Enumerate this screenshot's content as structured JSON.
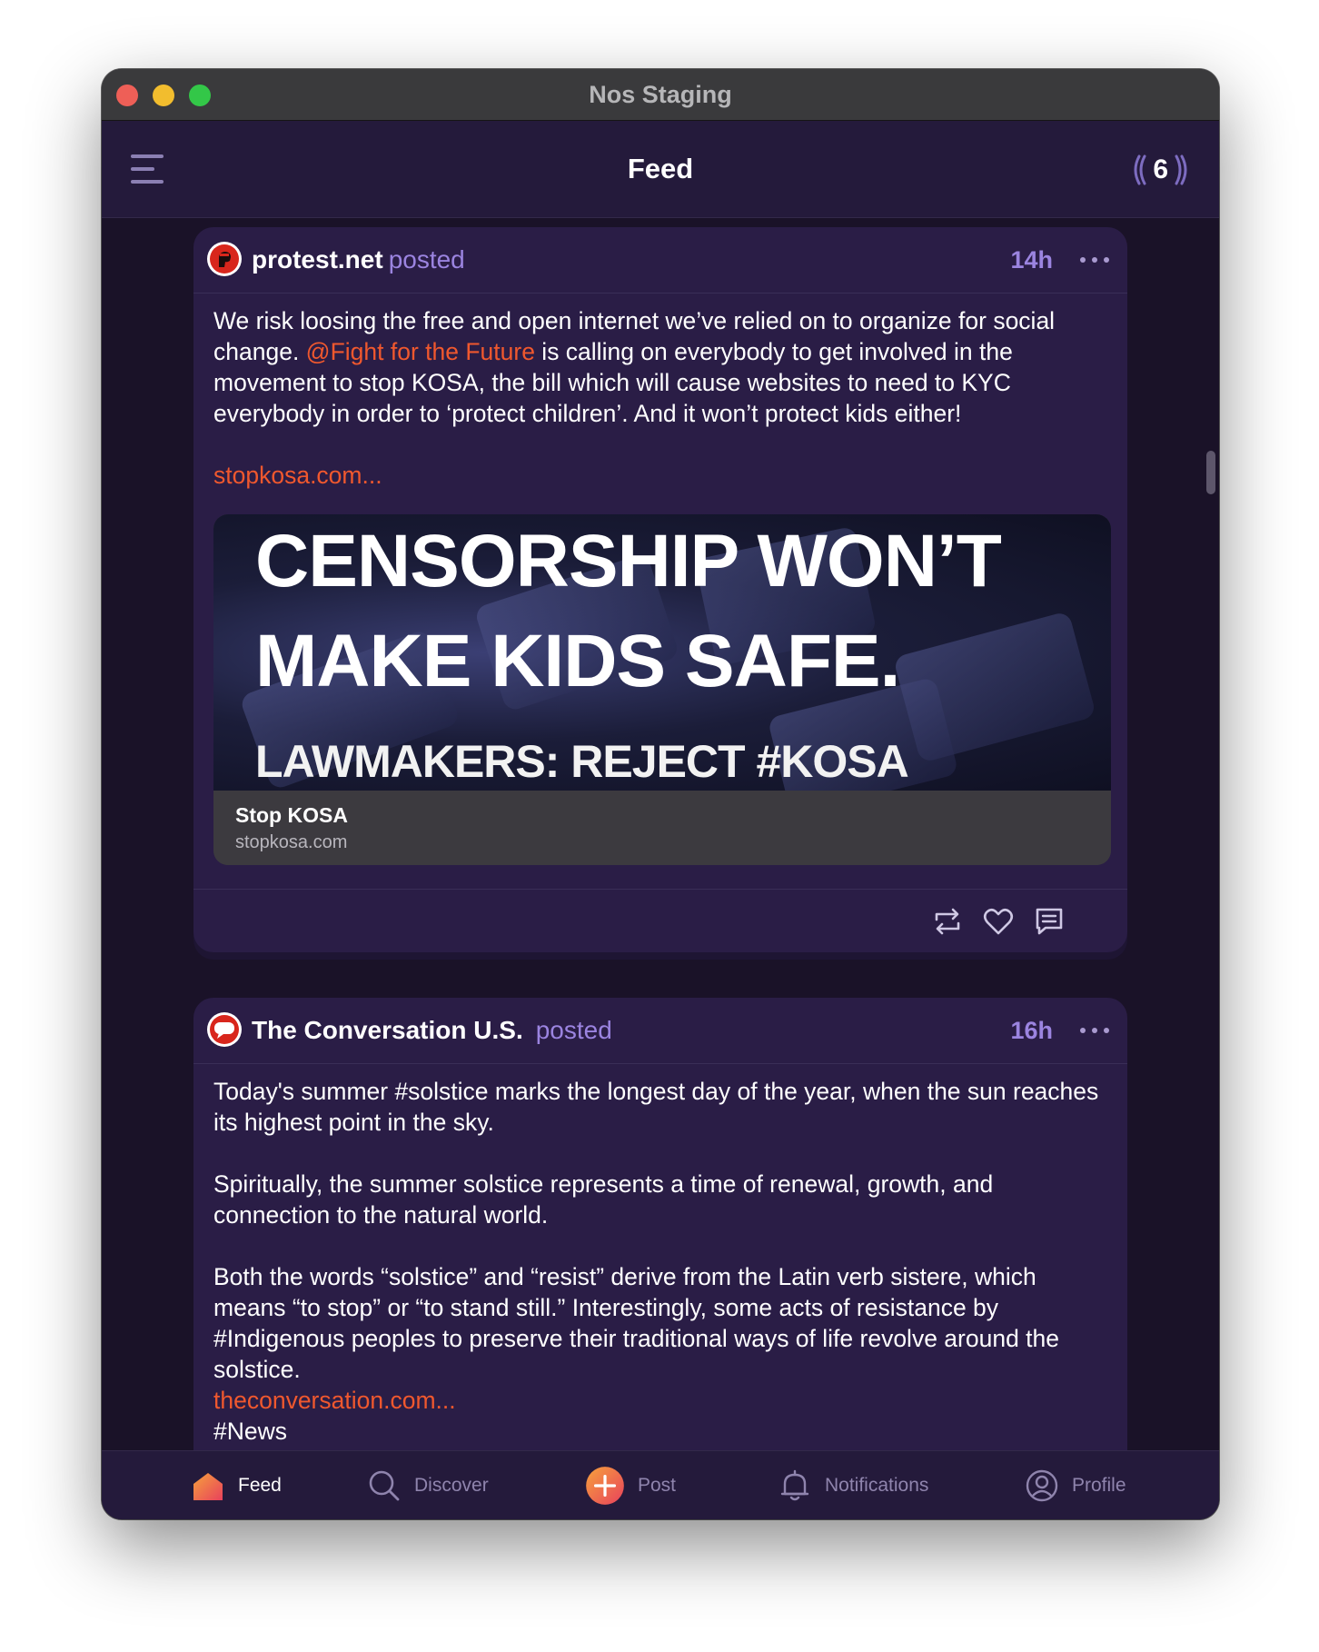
{
  "window": {
    "title": "Nos Staging"
  },
  "appbar": {
    "title": "Feed",
    "relay_count": "6"
  },
  "posts": [
    {
      "author": "protest.net",
      "action": "posted",
      "time": "14h",
      "body": {
        "text_before": "We risk loosing the free and open internet we’ve relied on to organize for social change. ",
        "mention": "@Fight for the Future",
        "text_after": " is calling on everybody to get involved in the movement to stop KOSA, the bill which will cause websites to need to KYC everybody in order to ‘protect children’. And it won’t protect kids either!",
        "link": "stopkosa.com..."
      },
      "preview": {
        "image_lines": [
          "CENSORSHIP WON’T",
          "MAKE KIDS SAFE.",
          "LAWMAKERS: REJECT #KOSA"
        ],
        "title": "Stop KOSA",
        "domain": "stopkosa.com"
      },
      "actions": [
        "repost-icon",
        "heart-icon",
        "reply-icon"
      ]
    },
    {
      "author": "The Conversation U.S.",
      "action": "posted",
      "time": "16h",
      "body": {
        "p1": "Today's summer #solstice marks the longest day of the year, when the sun reaches its highest point in the sky.",
        "p2": "Spiritually, the summer solstice represents a time of renewal, growth, and connection to the natural world.",
        "p3": "Both the words “solstice” and “resist” derive from the Latin verb sistere, which means “to stop” or “to stand still.” Interestingly, some acts of resistance by #Indigenous peoples to preserve their traditional ways of life revolve around the solstice.",
        "link": "theconversation.com...",
        "tag": "#News"
      }
    }
  ],
  "tabs": [
    {
      "label": "Feed",
      "icon": "home-icon",
      "active": true
    },
    {
      "label": "Discover",
      "icon": "search-icon",
      "active": false
    },
    {
      "label": "Post",
      "icon": "plus-icon",
      "active": false
    },
    {
      "label": "Notifications",
      "icon": "bell-icon",
      "active": false
    },
    {
      "label": "Profile",
      "icon": "profile-icon",
      "active": false
    }
  ],
  "colors": {
    "background": "#1a1228",
    "card": "#2a1d46",
    "accent_purple": "#9b84e0",
    "link_orange": "#f0582e"
  }
}
